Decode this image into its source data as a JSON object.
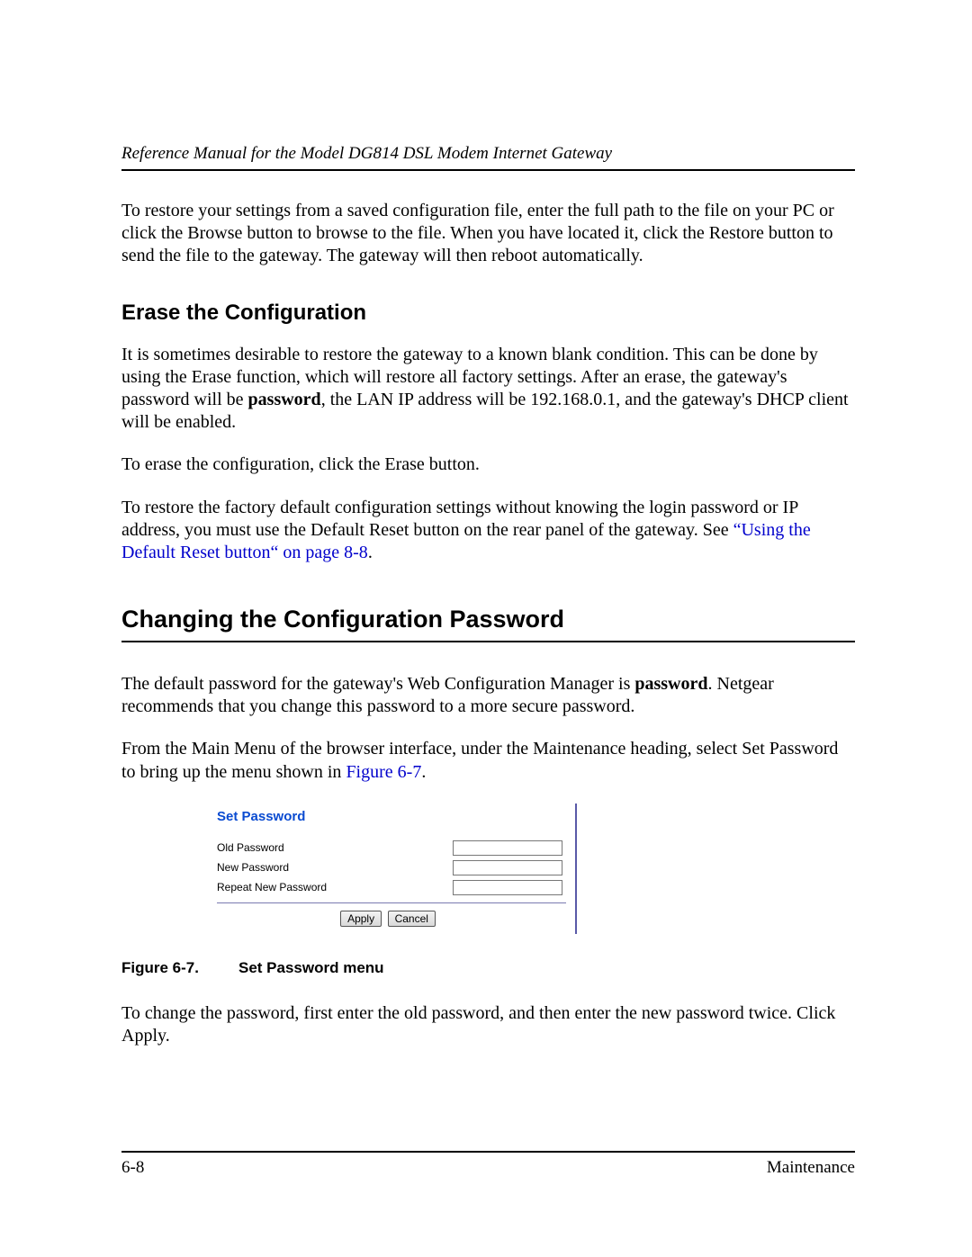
{
  "header": {
    "running": "Reference Manual for the Model DG814 DSL Modem Internet Gateway"
  },
  "paras": {
    "restore": "To restore your settings from a saved configuration file, enter the full path to the file on your PC or click the Browse button to browse to the file. When you have located it, click the Restore button to send the file to the gateway. The gateway will then reboot automatically.",
    "erase_heading": "Erase the Configuration",
    "erase1_a": "It is sometimes desirable to restore the gateway to a known blank condition. This can be done by using the Erase function, which will restore all factory settings. After an erase, the gateway's password will be ",
    "erase1_bold": "password",
    "erase1_b": ", the LAN IP address will be 192.168.0.1, and the gateway's DHCP client will be enabled.",
    "erase2": "To erase the configuration, click the Erase button.",
    "erase3_a": "To restore the factory default configuration settings without knowing the login password or IP address, you must use the Default Reset button on the rear panel of the gateway. See ",
    "erase3_link": "“Using the Default Reset button“ on page 8-8",
    "erase3_b": ".",
    "changepw_heading": "Changing the Configuration Password",
    "change1_a": "The default password for the gateway's Web Configuration Manager is ",
    "change1_bold": "password",
    "change1_b": ". Netgear recommends that you change this password to a more secure password.",
    "change2_a": "From the Main Menu of the browser interface, under the Maintenance heading, select Set Password to bring up the menu shown in ",
    "change2_link": "Figure 6-7",
    "change2_b": ".",
    "change3": "To change the password, first enter the old password, and then enter the new password twice. Click Apply."
  },
  "figure": {
    "title": "Set Password",
    "old_label": "Old Password",
    "new_label": "New Password",
    "repeat_label": "Repeat New Password",
    "old_value": "",
    "new_value": "",
    "repeat_value": "",
    "apply": "Apply",
    "cancel": "Cancel",
    "caption_num": "Figure 6-7.",
    "caption_text": "Set Password menu"
  },
  "footer": {
    "page": "6-8",
    "section": "Maintenance"
  }
}
